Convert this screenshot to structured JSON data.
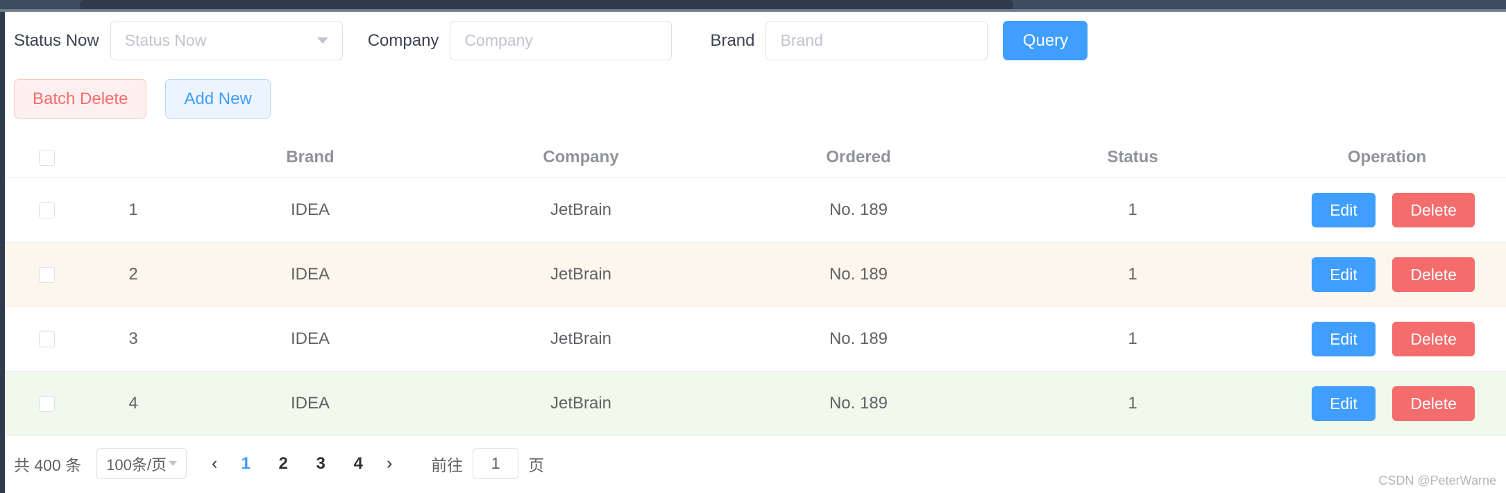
{
  "filters": {
    "status_label": "Status Now",
    "status_placeholder": "Status Now",
    "company_label": "Company",
    "company_placeholder": "Company",
    "brand_label": "Brand",
    "brand_placeholder": "Brand",
    "query_button": "Query"
  },
  "actions": {
    "batch_delete": "Batch Delete",
    "add_new": "Add New"
  },
  "table": {
    "headers": [
      "",
      "",
      "Brand",
      "Company",
      "Ordered",
      "Status",
      "Operation"
    ],
    "rows": [
      {
        "index": "1",
        "brand": "IDEA",
        "company": "JetBrain",
        "ordered": "No. 189",
        "status": "1",
        "edit": "Edit",
        "delete": "Delete",
        "highlight": "none"
      },
      {
        "index": "2",
        "brand": "IDEA",
        "company": "JetBrain",
        "ordered": "No. 189",
        "status": "1",
        "edit": "Edit",
        "delete": "Delete",
        "highlight": "amber"
      },
      {
        "index": "3",
        "brand": "IDEA",
        "company": "JetBrain",
        "ordered": "No. 189",
        "status": "1",
        "edit": "Edit",
        "delete": "Delete",
        "highlight": "none"
      },
      {
        "index": "4",
        "brand": "IDEA",
        "company": "JetBrain",
        "ordered": "No. 189",
        "status": "1",
        "edit": "Edit",
        "delete": "Delete",
        "highlight": "green"
      }
    ]
  },
  "pagination": {
    "total_text": "共 400 条",
    "page_size": "100条/页",
    "prev": "‹",
    "next": "›",
    "pages": [
      "1",
      "2",
      "3",
      "4"
    ],
    "active_page": "1",
    "jump_label": "前往",
    "jump_value": "1",
    "jump_suffix": "页"
  },
  "watermark": "CSDN @PeterWarne",
  "colors": {
    "primary": "#409eff",
    "danger": "#f56c6c",
    "header_bar": "#3f4d60",
    "row_amber": "#fdf6ec",
    "row_green": "#f0f9eb"
  }
}
